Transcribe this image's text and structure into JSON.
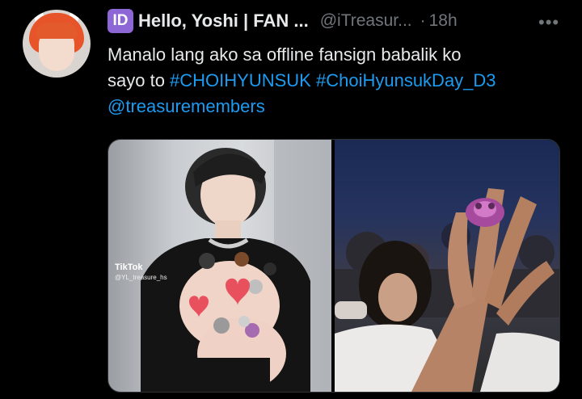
{
  "author": {
    "badge": "ID",
    "display_name": "Hello, Yoshi | FAN ...",
    "handle": "@iTreasur...",
    "separator": "·",
    "time": "18h",
    "more_label": "•••"
  },
  "tweet": {
    "text_line1": "Manalo lang ako sa offline fansign babalik ko",
    "text_line2_prefix": "sayo to ",
    "hashtag1": "#CHOIHYUNSUK",
    "hashtag2": "#ChoiHyunsukDay_D3",
    "mention": "@treasuremembers"
  },
  "media": {
    "left_watermark": "TikTok",
    "left_watermark_sub": "@YL_treasure_hs"
  },
  "colors": {
    "background": "#000000",
    "text": "#e7e9ea",
    "muted": "#71767b",
    "link": "#1d9bf0",
    "badge": "#8e67d6"
  }
}
